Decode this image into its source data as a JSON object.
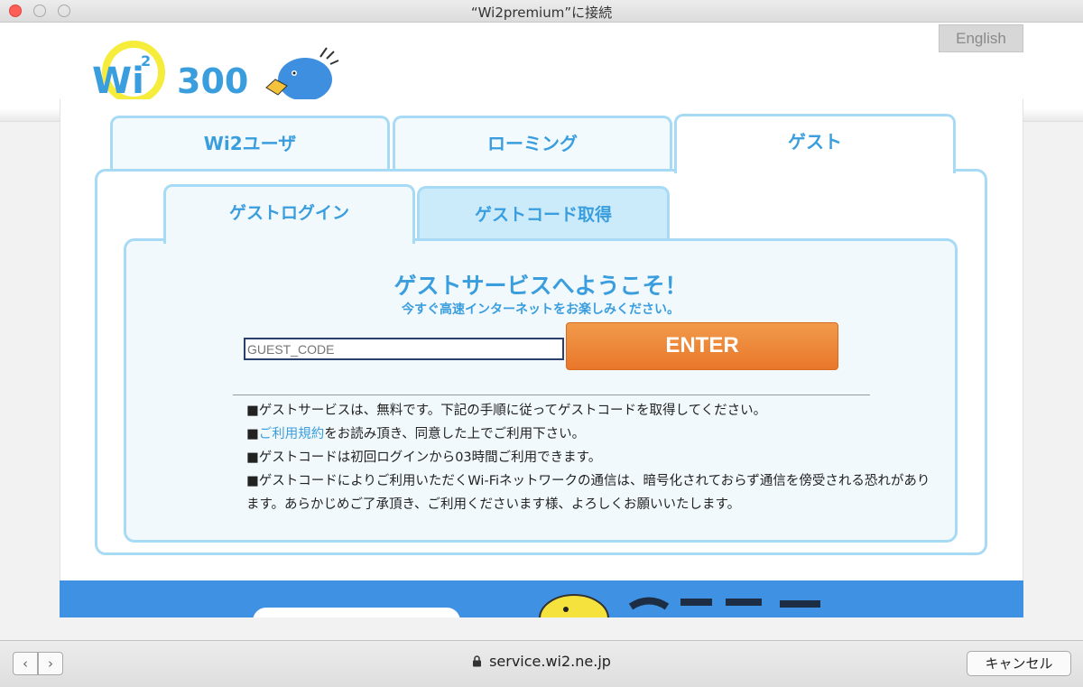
{
  "window": {
    "title": "“Wi2premium”に接続"
  },
  "header": {
    "logo_text": "Wi2 300",
    "language_button": "English"
  },
  "tabs": {
    "wi2_user": "Wi2ユーザ",
    "roaming": "ローミング",
    "guest": "ゲスト",
    "active": "guest"
  },
  "subtabs": {
    "guest_login": "ゲストログイン",
    "guest_code": "ゲストコード取得",
    "active": "guest_login"
  },
  "login": {
    "welcome_title": "ゲストサービスへようこそ！",
    "welcome_subtitle": "今すぐ高速インターネットをお楽しみください。",
    "code_placeholder": "GUEST_CODE",
    "enter_label": "ENTER"
  },
  "notes": {
    "line1": "■ゲストサービスは、無料です。下記の手順に従ってゲストコードを取得してください。",
    "line2_prefix": "■",
    "line2_link": "ご利用規約",
    "line2_suffix": "をお読み頂き、同意した上でご利用下さい。",
    "line3": "■ゲストコードは初回ログインから03時間ご利用できます。",
    "line4": "■ゲストコードによりご利用いただくWi-Fiネットワークの通信は、暗号化されておらず通信を傍受される恐れがあります。あらかじめご了承頂き、ご利用くださいます様、よろしくお願いいたします。"
  },
  "toolbar": {
    "back": "‹",
    "forward": "›",
    "url": "service.wi2.ne.jp",
    "cancel_label": "キャンセル"
  },
  "colors": {
    "accent": "#3a9ede",
    "tab_border": "#a7daf4",
    "enter_button": "#ec822f",
    "footer_banner": "#3f91e4"
  }
}
